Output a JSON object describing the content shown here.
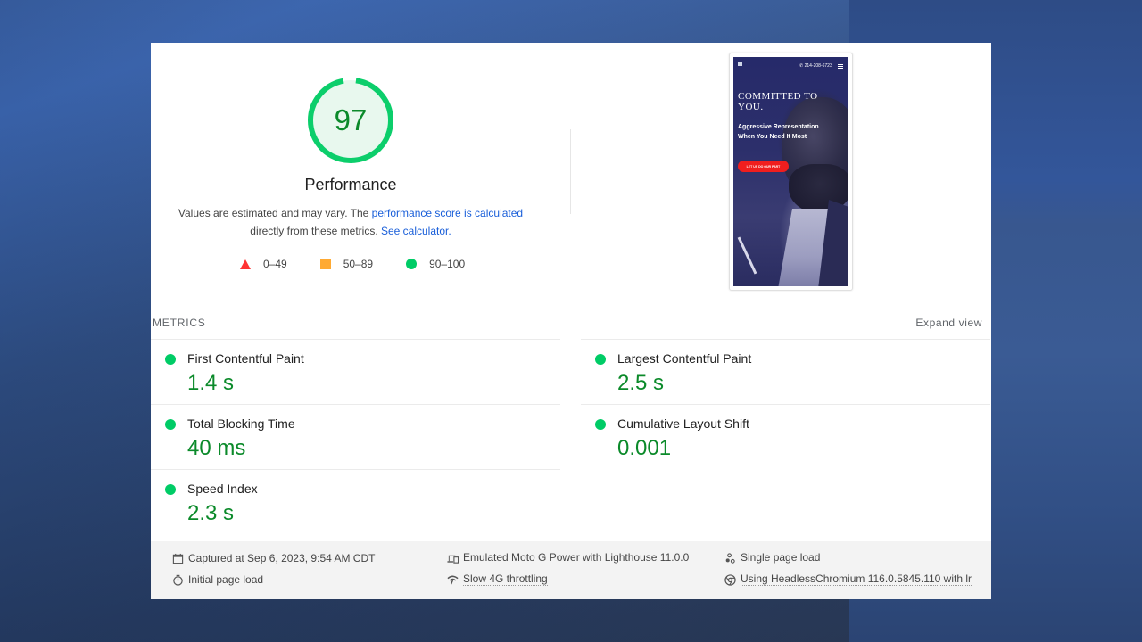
{
  "gauge": {
    "score": "97",
    "score_fraction": 0.97,
    "title": "Performance",
    "color": "#0cce6b",
    "fill": "#e8f8ee",
    "text_color": "#008800"
  },
  "description": {
    "text_before": "Values are estimated and may vary. The ",
    "link_score": "performance score is calculated",
    "text_middle": " directly from these metrics. ",
    "link_calculator": "See calculator."
  },
  "legend": [
    {
      "icon": "triangle-icon",
      "label": "0–49",
      "color": "#ff3333"
    },
    {
      "icon": "square-icon",
      "label": "50–89",
      "color": "#ffaa33"
    },
    {
      "icon": "circle-icon",
      "label": "90–100",
      "color": "#00cc66"
    }
  ],
  "screenshot": {
    "phone": "214-208-6723",
    "headline": "COMMITTED TO YOU.",
    "subheadline": "Aggressive Representation When You Need It Most",
    "cta": "LET US DO OUR PART"
  },
  "metrics": {
    "header": "METRICS",
    "expand_label": "Expand view",
    "left": [
      {
        "name": "First Contentful Paint",
        "value": "1.4 s",
        "status": "good"
      },
      {
        "name": "Total Blocking Time",
        "value": "40 ms",
        "status": "good"
      },
      {
        "name": "Speed Index",
        "value": "2.3 s",
        "status": "good"
      }
    ],
    "right": [
      {
        "name": "Largest Contentful Paint",
        "value": "2.5 s",
        "status": "good"
      },
      {
        "name": "Cumulative Layout Shift",
        "value": "0.001",
        "status": "good"
      }
    ]
  },
  "footer": {
    "captured": "Captured at Sep 6, 2023, 9:54 AM CDT",
    "initial_load": "Initial page load",
    "emulated": "Emulated Moto G Power with Lighthouse 11.0.0",
    "throttling": "Slow 4G throttling",
    "single_load": "Single page load",
    "browser": "Using HeadlessChromium 116.0.5845.110 with lr"
  }
}
